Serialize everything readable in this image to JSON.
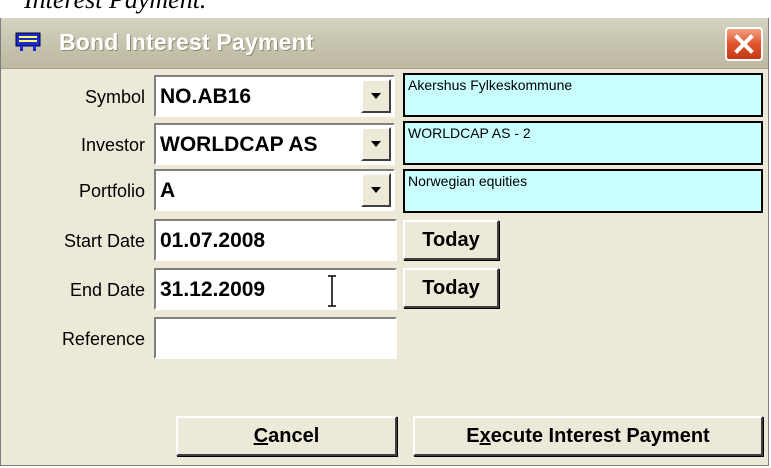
{
  "caption": "Interest Payment.",
  "window": {
    "title": "Bond Interest Payment"
  },
  "form": {
    "symbol": {
      "label": "Symbol",
      "value": "NO.AB16",
      "description": "Akershus Fylkeskommune"
    },
    "investor": {
      "label": "Investor",
      "value": "WORLDCAP AS",
      "description": "WORLDCAP AS - 2"
    },
    "portfolio": {
      "label": "Portfolio",
      "value": "A",
      "description": "Norwegian equities"
    },
    "start_date": {
      "label": "Start Date",
      "value": "01.07.2008",
      "button": "Today"
    },
    "end_date": {
      "label": "End Date",
      "value": "31.12.2009",
      "button": "Today"
    },
    "reference": {
      "label": "Reference",
      "value": ""
    }
  },
  "buttons": {
    "cancel": {
      "pre": "",
      "mnemonic": "C",
      "post": "ancel"
    },
    "execute": {
      "pre": "E",
      "mnemonic": "x",
      "post": "ecute Interest Payment"
    }
  },
  "colors": {
    "info_background": "#c8fefe",
    "close_button": "#e0542d",
    "window_background": "#ece9d8"
  },
  "icons": {
    "app": "window-app-icon",
    "close": "close-icon",
    "dropdown": "dropdown-arrow-icon",
    "cursor": "text-cursor-icon"
  }
}
